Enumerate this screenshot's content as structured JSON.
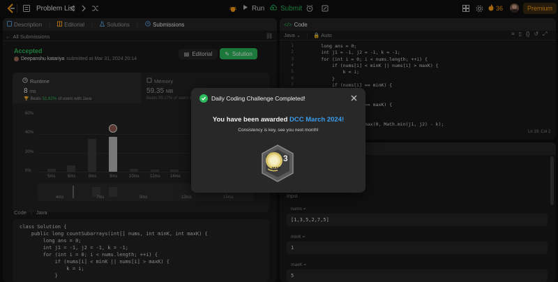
{
  "nav": {
    "problem_list": "Problem List",
    "run": "Run",
    "submit": "Submit",
    "streak": "36",
    "premium": "Premium"
  },
  "left_tabs": [
    "Description",
    "Editorial",
    "Solutions",
    "Submissions"
  ],
  "submission": {
    "back": "All Submissions",
    "status": "Accepted",
    "user": "Deepanshu katariya",
    "submitted": "submitted at Mar 31, 2024 20:14",
    "editorial_btn": "Editorial",
    "solution_btn": "Solution",
    "runtime_label": "Runtime",
    "runtime_value": "8",
    "runtime_unit": "ms",
    "runtime_beats_prefix": "Beats",
    "runtime_beats_pct": "51.62%",
    "runtime_beats_suffix": "of users with Java",
    "memory_label": "Memory",
    "memory_value": "59.35",
    "memory_unit": "MB",
    "memory_beats": "Beats 99.17% of users with Java"
  },
  "dist_chart": {
    "y_ticks": [
      "60%",
      "40%",
      "20%",
      "0%"
    ],
    "x_labels": [
      "5ms",
      "6ms",
      "8ms",
      "9ms",
      "10ms",
      "12ms",
      "14ms"
    ],
    "x_labels_lower": [
      "4ms",
      "7ms",
      "9ms",
      "13ms",
      "15ms"
    ]
  },
  "code_tabs": {
    "code": "Code",
    "lang": "Java"
  },
  "left_code": [
    "class Solution {",
    "    public long countSubarrays(int[] nums, int minK, int maxK) {",
    "        long ans = 0;",
    "        int j1 = -1, j2 = -1, k = -1;",
    "        for (int i = 0; i < nums.length; ++i) {",
    "            if (nums[i] < minK || nums[i] > maxK) {",
    "                k = i;",
    "            }"
  ],
  "editor": {
    "title": "Code",
    "lang": "Java",
    "auto": "Auto",
    "lines": [
      "        long ans = 0;",
      "        int j1 = -1, j2 = -1, k = -1;",
      "        for (int i = 0; i < nums.length; ++i) {",
      "            if (nums[i] < minK || nums[i] > maxK) {",
      "                k = i;",
      "            }",
      "            if (nums[i] == minK) {",
      "",
      "",
      "            if (nums[i] == maxK) {",
      "",
      "",
      "            ans += Math.max(0, Math.min(j1, j2) - k);"
    ],
    "line_numbers": [
      "1",
      "2",
      "3",
      "4",
      "5",
      "6",
      "7",
      "8",
      "9",
      "10",
      "11",
      "12",
      "13"
    ],
    "cursor": "Ln 19, Col 2"
  },
  "testcase": {
    "input_label": "Input",
    "nums_label": "nums =",
    "nums_value": "[1,3,5,2,7,5]",
    "minK_label": "minK =",
    "minK_value": "1",
    "maxK_label": "maxK =",
    "maxK_value": "5"
  },
  "modal": {
    "title": "Daily Coding Challenge Completed!",
    "award_prefix": "You have been awarded",
    "award_highlight": "DCC March 2024!",
    "subtitle": "Consistency is key, see you next month!",
    "badge_number": "3",
    "badge_month": "MAR"
  },
  "colors": {
    "accent_green": "#2cbb5d",
    "award_blue": "#3b9ded",
    "premium": "#ffa116"
  }
}
